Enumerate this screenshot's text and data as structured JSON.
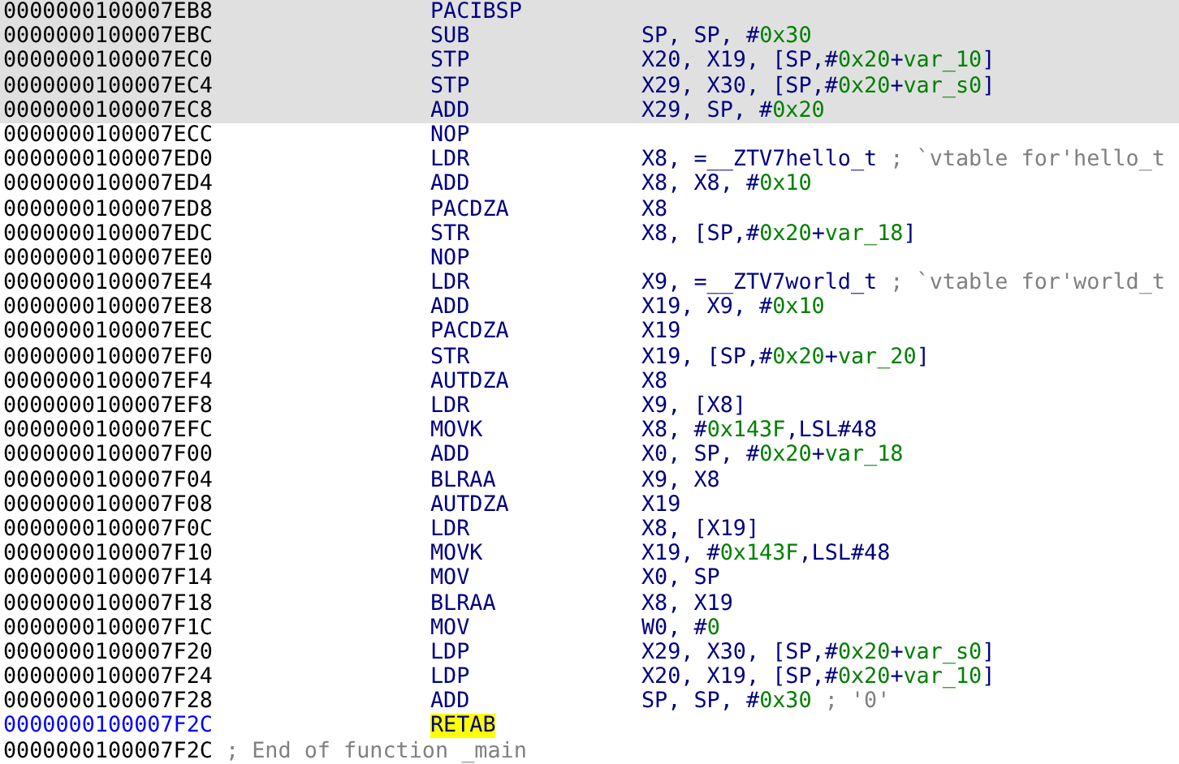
{
  "listing": {
    "rows": [
      {
        "kind": "insn",
        "address": "0000000100007EB8",
        "mnemonic": "PACIBSP",
        "highlighted": true,
        "cursor": false,
        "marked": false,
        "operand": []
      },
      {
        "kind": "insn",
        "address": "0000000100007EBC",
        "mnemonic": "SUB",
        "highlighted": true,
        "cursor": false,
        "marked": false,
        "operand": [
          {
            "kind": "op",
            "text": "SP, SP, #"
          },
          {
            "kind": "num",
            "text": "0x30"
          }
        ]
      },
      {
        "kind": "insn",
        "address": "0000000100007EC0",
        "mnemonic": "STP",
        "highlighted": true,
        "cursor": false,
        "marked": false,
        "operand": [
          {
            "kind": "op",
            "text": "X20, X19, [SP,#"
          },
          {
            "kind": "num",
            "text": "0x20"
          },
          {
            "kind": "op",
            "text": "+"
          },
          {
            "kind": "num",
            "text": "var_10"
          },
          {
            "kind": "op",
            "text": "]"
          }
        ]
      },
      {
        "kind": "insn",
        "address": "0000000100007EC4",
        "mnemonic": "STP",
        "highlighted": true,
        "cursor": false,
        "marked": false,
        "operand": [
          {
            "kind": "op",
            "text": "X29, X30, [SP,#"
          },
          {
            "kind": "num",
            "text": "0x20"
          },
          {
            "kind": "op",
            "text": "+"
          },
          {
            "kind": "num",
            "text": "var_s0"
          },
          {
            "kind": "op",
            "text": "]"
          }
        ]
      },
      {
        "kind": "insn",
        "address": "0000000100007EC8",
        "mnemonic": "ADD",
        "highlighted": true,
        "cursor": false,
        "marked": false,
        "operand": [
          {
            "kind": "op",
            "text": "X29, SP, #"
          },
          {
            "kind": "num",
            "text": "0x20"
          }
        ]
      },
      {
        "kind": "insn",
        "address": "0000000100007ECC",
        "mnemonic": "NOP",
        "highlighted": false,
        "cursor": false,
        "marked": false,
        "operand": []
      },
      {
        "kind": "insn",
        "address": "0000000100007ED0",
        "mnemonic": "LDR",
        "highlighted": false,
        "cursor": false,
        "marked": false,
        "operand": [
          {
            "kind": "op",
            "text": "X8, =__ZTV7hello_t"
          },
          {
            "kind": "comment",
            "text": "; `vtable for'hello_t"
          }
        ]
      },
      {
        "kind": "insn",
        "address": "0000000100007ED4",
        "mnemonic": "ADD",
        "highlighted": false,
        "cursor": false,
        "marked": false,
        "operand": [
          {
            "kind": "op",
            "text": "X8, X8, #"
          },
          {
            "kind": "num",
            "text": "0x10"
          }
        ]
      },
      {
        "kind": "insn",
        "address": "0000000100007ED8",
        "mnemonic": "PACDZA",
        "highlighted": false,
        "cursor": false,
        "marked": false,
        "operand": [
          {
            "kind": "op",
            "text": "X8"
          }
        ]
      },
      {
        "kind": "insn",
        "address": "0000000100007EDC",
        "mnemonic": "STR",
        "highlighted": false,
        "cursor": false,
        "marked": false,
        "operand": [
          {
            "kind": "op",
            "text": "X8, [SP,#"
          },
          {
            "kind": "num",
            "text": "0x20"
          },
          {
            "kind": "op",
            "text": "+"
          },
          {
            "kind": "num",
            "text": "var_18"
          },
          {
            "kind": "op",
            "text": "]"
          }
        ]
      },
      {
        "kind": "insn",
        "address": "0000000100007EE0",
        "mnemonic": "NOP",
        "highlighted": false,
        "cursor": false,
        "marked": false,
        "operand": []
      },
      {
        "kind": "insn",
        "address": "0000000100007EE4",
        "mnemonic": "LDR",
        "highlighted": false,
        "cursor": false,
        "marked": false,
        "operand": [
          {
            "kind": "op",
            "text": "X9, =__ZTV7world_t"
          },
          {
            "kind": "comment",
            "text": "; `vtable for'world_t"
          }
        ]
      },
      {
        "kind": "insn",
        "address": "0000000100007EE8",
        "mnemonic": "ADD",
        "highlighted": false,
        "cursor": false,
        "marked": false,
        "operand": [
          {
            "kind": "op",
            "text": "X19, X9, #"
          },
          {
            "kind": "num",
            "text": "0x10"
          }
        ]
      },
      {
        "kind": "insn",
        "address": "0000000100007EEC",
        "mnemonic": "PACDZA",
        "highlighted": false,
        "cursor": false,
        "marked": false,
        "operand": [
          {
            "kind": "op",
            "text": "X19"
          }
        ]
      },
      {
        "kind": "insn",
        "address": "0000000100007EF0",
        "mnemonic": "STR",
        "highlighted": false,
        "cursor": false,
        "marked": false,
        "operand": [
          {
            "kind": "op",
            "text": "X19, [SP,#"
          },
          {
            "kind": "num",
            "text": "0x20"
          },
          {
            "kind": "op",
            "text": "+"
          },
          {
            "kind": "num",
            "text": "var_20"
          },
          {
            "kind": "op",
            "text": "]"
          }
        ]
      },
      {
        "kind": "insn",
        "address": "0000000100007EF4",
        "mnemonic": "AUTDZA",
        "highlighted": false,
        "cursor": false,
        "marked": false,
        "operand": [
          {
            "kind": "op",
            "text": "X8"
          }
        ]
      },
      {
        "kind": "insn",
        "address": "0000000100007EF8",
        "mnemonic": "LDR",
        "highlighted": false,
        "cursor": false,
        "marked": false,
        "operand": [
          {
            "kind": "op",
            "text": "X9, [X8]"
          }
        ]
      },
      {
        "kind": "insn",
        "address": "0000000100007EFC",
        "mnemonic": "MOVK",
        "highlighted": false,
        "cursor": false,
        "marked": false,
        "operand": [
          {
            "kind": "op",
            "text": "X8, #"
          },
          {
            "kind": "num",
            "text": "0x143F"
          },
          {
            "kind": "op",
            "text": ",LSL#48"
          }
        ]
      },
      {
        "kind": "insn",
        "address": "0000000100007F00",
        "mnemonic": "ADD",
        "highlighted": false,
        "cursor": false,
        "marked": false,
        "operand": [
          {
            "kind": "op",
            "text": "X0, SP, #"
          },
          {
            "kind": "num",
            "text": "0x20"
          },
          {
            "kind": "op",
            "text": "+"
          },
          {
            "kind": "num",
            "text": "var_18"
          }
        ]
      },
      {
        "kind": "insn",
        "address": "0000000100007F04",
        "mnemonic": "BLRAA",
        "highlighted": false,
        "cursor": false,
        "marked": false,
        "operand": [
          {
            "kind": "op",
            "text": "X9, X8"
          }
        ]
      },
      {
        "kind": "insn",
        "address": "0000000100007F08",
        "mnemonic": "AUTDZA",
        "highlighted": false,
        "cursor": false,
        "marked": false,
        "operand": [
          {
            "kind": "op",
            "text": "X19"
          }
        ]
      },
      {
        "kind": "insn",
        "address": "0000000100007F0C",
        "mnemonic": "LDR",
        "highlighted": false,
        "cursor": false,
        "marked": false,
        "operand": [
          {
            "kind": "op",
            "text": "X8, [X19]"
          }
        ]
      },
      {
        "kind": "insn",
        "address": "0000000100007F10",
        "mnemonic": "MOVK",
        "highlighted": false,
        "cursor": false,
        "marked": false,
        "operand": [
          {
            "kind": "op",
            "text": "X19, #"
          },
          {
            "kind": "num",
            "text": "0x143F"
          },
          {
            "kind": "op",
            "text": ",LSL#48"
          }
        ]
      },
      {
        "kind": "insn",
        "address": "0000000100007F14",
        "mnemonic": "MOV",
        "highlighted": false,
        "cursor": false,
        "marked": false,
        "operand": [
          {
            "kind": "op",
            "text": "X0, SP"
          }
        ]
      },
      {
        "kind": "insn",
        "address": "0000000100007F18",
        "mnemonic": "BLRAA",
        "highlighted": false,
        "cursor": false,
        "marked": false,
        "operand": [
          {
            "kind": "op",
            "text": "X8, X19"
          }
        ]
      },
      {
        "kind": "insn",
        "address": "0000000100007F1C",
        "mnemonic": "MOV",
        "highlighted": false,
        "cursor": false,
        "marked": false,
        "operand": [
          {
            "kind": "op",
            "text": "W0, #"
          },
          {
            "kind": "num",
            "text": "0"
          }
        ]
      },
      {
        "kind": "insn",
        "address": "0000000100007F20",
        "mnemonic": "LDP",
        "highlighted": false,
        "cursor": false,
        "marked": false,
        "operand": [
          {
            "kind": "op",
            "text": "X29, X30, [SP,#"
          },
          {
            "kind": "num",
            "text": "0x20"
          },
          {
            "kind": "op",
            "text": "+"
          },
          {
            "kind": "num",
            "text": "var_s0"
          },
          {
            "kind": "op",
            "text": "]"
          }
        ]
      },
      {
        "kind": "insn",
        "address": "0000000100007F24",
        "mnemonic": "LDP",
        "highlighted": false,
        "cursor": false,
        "marked": false,
        "operand": [
          {
            "kind": "op",
            "text": "X20, X19, [SP,#"
          },
          {
            "kind": "num",
            "text": "0x20"
          },
          {
            "kind": "op",
            "text": "+"
          },
          {
            "kind": "num",
            "text": "var_10"
          },
          {
            "kind": "op",
            "text": "]"
          }
        ]
      },
      {
        "kind": "insn",
        "address": "0000000100007F28",
        "mnemonic": "ADD",
        "highlighted": false,
        "cursor": false,
        "marked": false,
        "operand": [
          {
            "kind": "op",
            "text": "SP, SP, #"
          },
          {
            "kind": "num",
            "text": "0x30"
          },
          {
            "kind": "comment",
            "text": "; '0'"
          }
        ]
      },
      {
        "kind": "insn",
        "address": "0000000100007F2C",
        "mnemonic": "RETAB",
        "highlighted": false,
        "cursor": true,
        "marked": true,
        "operand": []
      },
      {
        "kind": "end",
        "address": "0000000100007F2C",
        "comment": "; End of function _main",
        "highlighted": false,
        "cursor": false
      }
    ]
  }
}
